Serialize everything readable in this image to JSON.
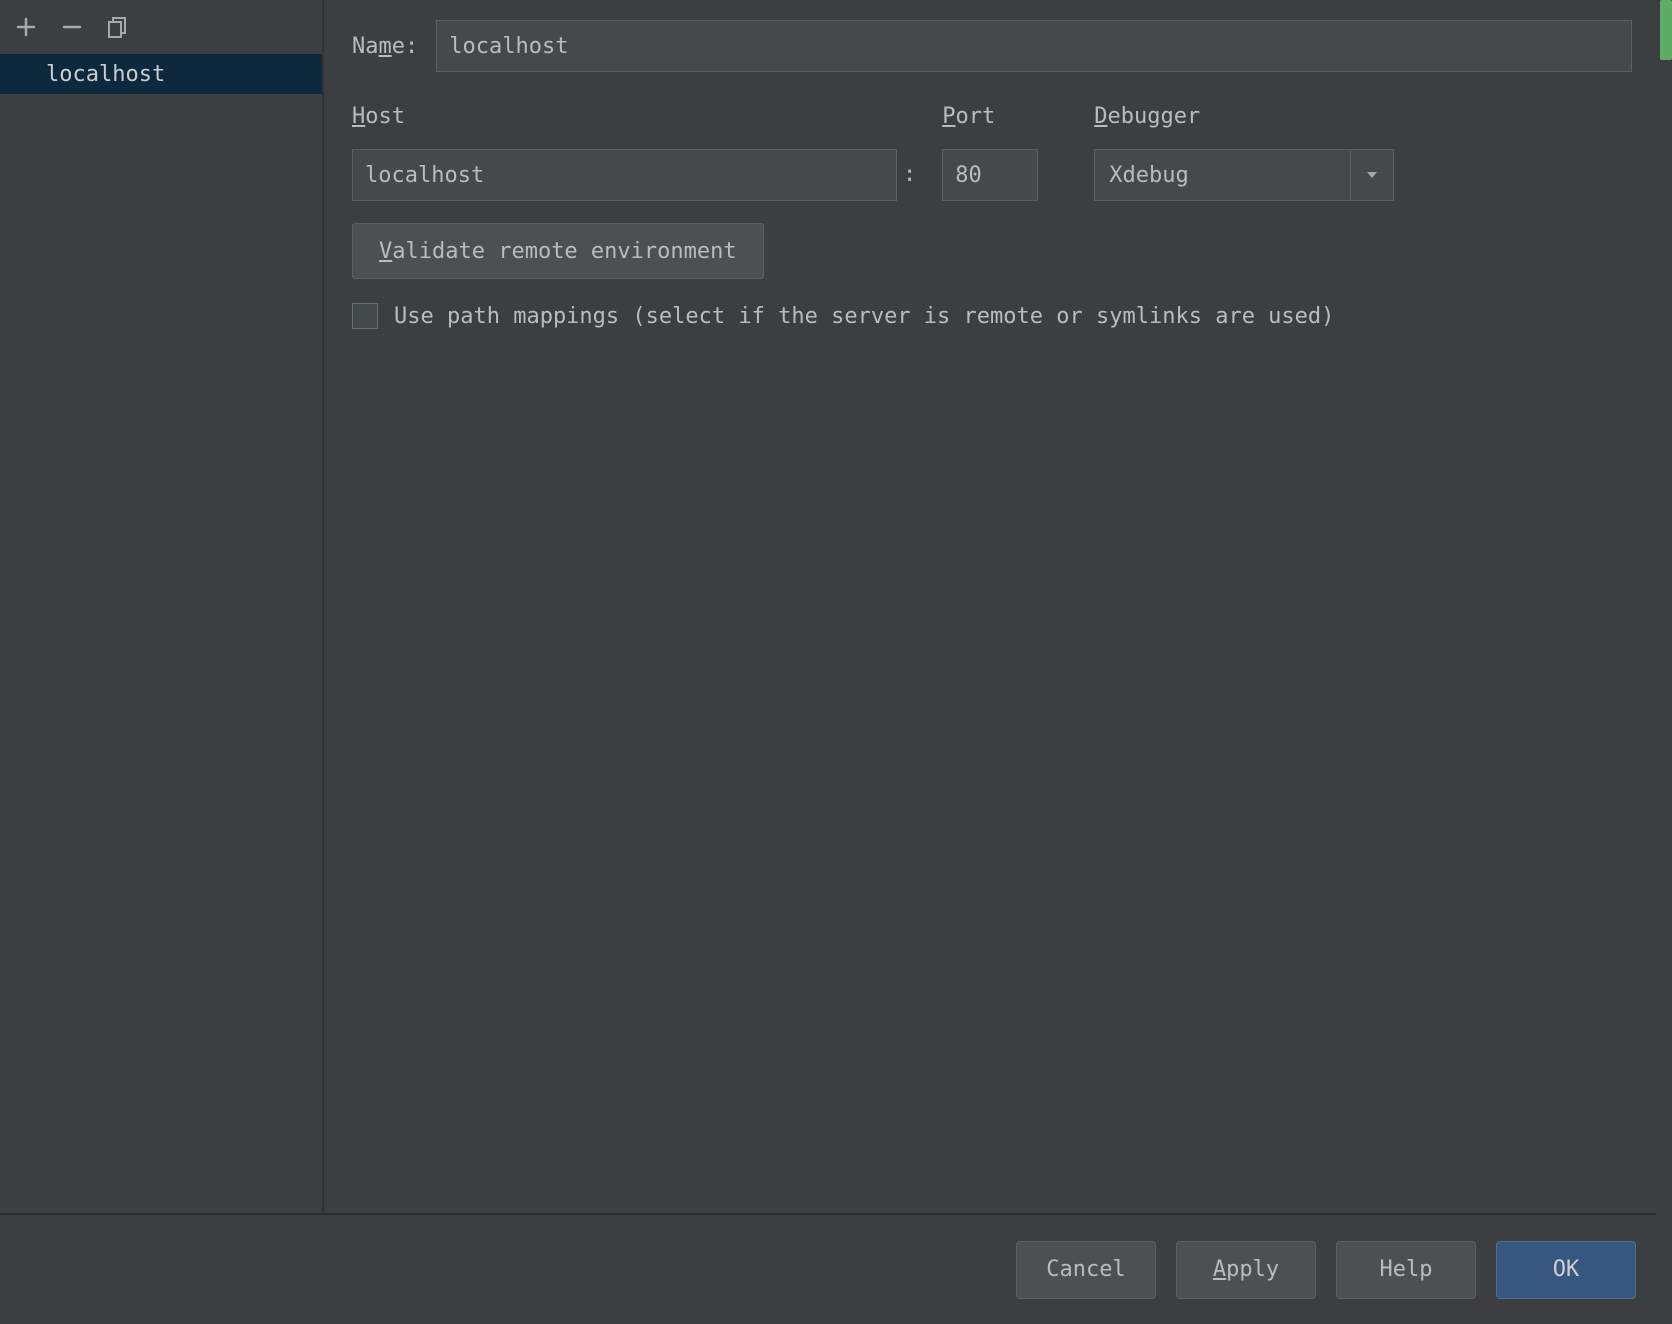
{
  "sidebar": {
    "items": [
      {
        "label": "localhost",
        "selected": true
      }
    ]
  },
  "form": {
    "name_label_pre": "Na",
    "name_label_mn": "m",
    "name_label_post": "e:",
    "name_value": "localhost",
    "host_label_mn": "H",
    "host_label_post": "ost",
    "host_value": "localhost",
    "port_label_mn": "P",
    "port_label_post": "ort",
    "port_value": "80",
    "colon": ":",
    "debugger_label_mn": "D",
    "debugger_label_post": "ebugger",
    "debugger_value": "Xdebug",
    "validate_mn": "V",
    "validate_post": "alidate remote environment",
    "path_mappings_label": "Use path mappings (select if the server is remote or symlinks are used)"
  },
  "buttons": {
    "cancel": "Cancel",
    "apply_mn": "A",
    "apply_post": "pply",
    "help": "Help",
    "ok": "OK"
  }
}
